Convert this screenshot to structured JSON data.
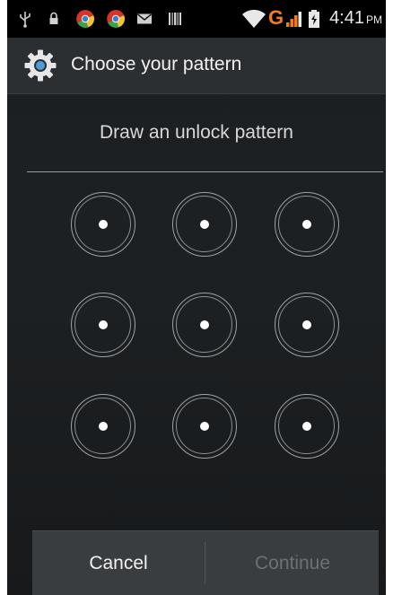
{
  "status_bar": {
    "icons": [
      "usb-icon",
      "lock-icon",
      "chrome-icon",
      "chrome-icon",
      "mail-icon",
      "barcode-icon",
      "wifi-icon",
      "signal-icon",
      "battery-icon"
    ],
    "network_type": "G",
    "time": "4:41",
    "ampm": "PM"
  },
  "action_bar": {
    "icon": "settings-gear-icon",
    "title": "Choose your pattern"
  },
  "main": {
    "header": "Draw an unlock pattern",
    "pattern_nodes": [
      1,
      2,
      3,
      4,
      5,
      6,
      7,
      8,
      9
    ]
  },
  "buttons": {
    "cancel": "Cancel",
    "continue": "Continue"
  },
  "colors": {
    "network_accent": "#f07d18",
    "background": "#1c1f21",
    "action_bar": "#2c2f31",
    "button_bar": "#3a3d3f",
    "disabled_text": "#6e7173"
  }
}
